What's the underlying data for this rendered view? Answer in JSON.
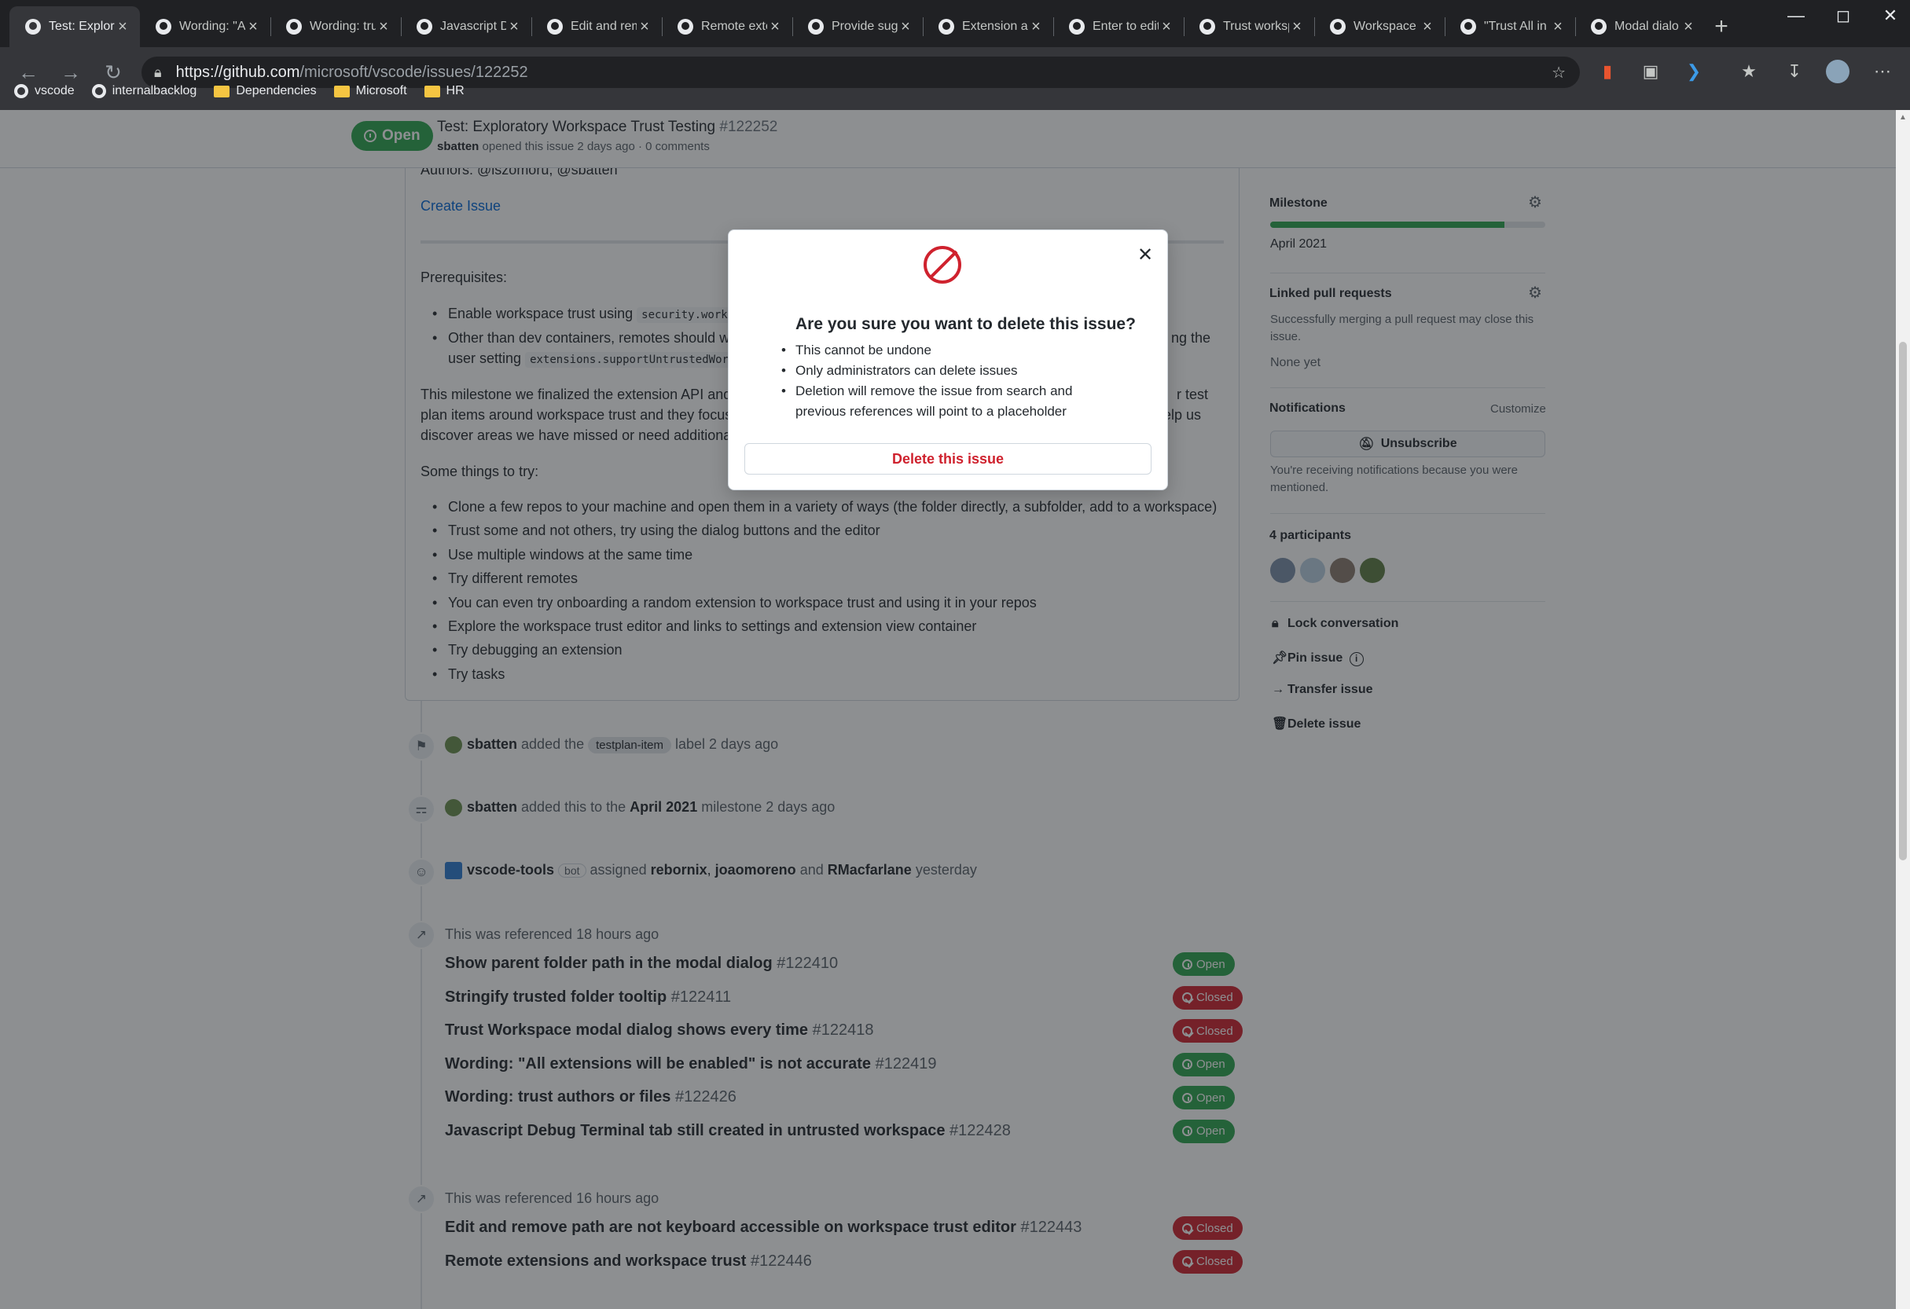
{
  "browser": {
    "tabs": [
      {
        "label": "Test: Explora",
        "active": true
      },
      {
        "label": "Wording: \"Al"
      },
      {
        "label": "Wording: tru"
      },
      {
        "label": "Javascript De"
      },
      {
        "label": "Edit and rem"
      },
      {
        "label": "Remote exte"
      },
      {
        "label": "Provide sugg"
      },
      {
        "label": "Extension ac"
      },
      {
        "label": "Enter to edit"
      },
      {
        "label": "Trust worksp"
      },
      {
        "label": "Workspace t"
      },
      {
        "label": "\"Trust All in"
      },
      {
        "label": "Modal dialo"
      }
    ],
    "url_host": "https://github.com",
    "url_path": "/microsoft/vscode/issues/122252",
    "bookmarks": [
      {
        "label": "vscode",
        "icon": "github-icon"
      },
      {
        "label": "internalbacklog",
        "icon": "github-icon"
      },
      {
        "label": "Dependencies",
        "icon": "folder-icon"
      },
      {
        "label": "Microsoft",
        "icon": "folder-icon"
      },
      {
        "label": "HR",
        "icon": "folder-icon"
      }
    ]
  },
  "issue": {
    "state": "Open",
    "title": "Test: Exploratory Workspace Trust Testing",
    "number": "#122252",
    "author": "sbatten",
    "meta": "opened this issue 2 days ago · 0 comments"
  },
  "comment": {
    "authors_line": "Authors: @iszomoru, @sbatten",
    "create_issue": "Create Issue",
    "prereq": "Prerequisites:",
    "bullet1_text": "Enable workspace trust using",
    "bullet1_code": "security.worksp",
    "bullet2_text_a": "Other than dev containers, remotes should wo",
    "bullet2_text_b": "ng the",
    "bullet2_text_c": "user setting",
    "bullet2_code": "extensions.supportUntrustedWork",
    "para1_l1a": "This milestone we finalized the extension API and h",
    "para1_l1b": "r test",
    "para1_l2a": "plan items around workspace trust and they focus",
    "para1_l2b": "elp us",
    "para1_l3": "discover areas we have missed or need additional l",
    "try_heading": "Some things to try:",
    "try_items": [
      "Clone a few repos to your machine and open them in a variety of ways (the folder directly, a subfolder, add to a workspace)",
      "Trust some and not others, try using the dialog buttons and the editor",
      "Use multiple windows at the same time",
      "Try different remotes",
      "You can even try onboarding a random extension to workspace trust and using it in your repos",
      "Explore the workspace trust editor and links to settings and extension view container",
      "Try debugging an extension",
      "Try tasks"
    ]
  },
  "timeline": {
    "label_event": {
      "user": "sbatten",
      "pre": "added the",
      "label": "testplan-item",
      "post": "label 2 days ago"
    },
    "milestone_event": {
      "user": "sbatten",
      "pre": "added this to the",
      "milestone": "April 2021",
      "post": "milestone 2 days ago"
    },
    "assign_event": {
      "user": "vscode-tools",
      "bot": "bot",
      "pre": "assigned",
      "a1": "rebornix",
      "a2": "joaomoreno",
      "and": "and",
      "a3": "RMacfarlane",
      "post": "yesterday"
    },
    "ref_group1": {
      "header": "This was referenced 18 hours ago",
      "items": [
        {
          "title": "Show parent folder path in the modal dialog",
          "num": "#122410",
          "state": "Open"
        },
        {
          "title": "Stringify trusted folder tooltip",
          "num": "#122411",
          "state": "Closed"
        },
        {
          "title": "Trust Workspace modal dialog shows every time",
          "num": "#122418",
          "state": "Closed"
        },
        {
          "title": "Wording: \"All extensions will be enabled\" is not accurate",
          "num": "#122419",
          "state": "Open"
        },
        {
          "title": "Wording: trust authors or files",
          "num": "#122426",
          "state": "Open"
        },
        {
          "title": "Javascript Debug Terminal tab still created in untrusted workspace",
          "num": "#122428",
          "state": "Open"
        }
      ]
    },
    "ref_group2": {
      "header": "This was referenced 16 hours ago",
      "items": [
        {
          "title": "Edit and remove path are not keyboard accessible on workspace trust editor",
          "num": "#122443",
          "state": "Closed"
        },
        {
          "title": "Remote extensions and workspace trust",
          "num": "#122446",
          "state": "Closed"
        }
      ]
    }
  },
  "sidebar": {
    "milestone_heading": "Milestone",
    "milestone_name": "April 2021",
    "milestone_progress": 0.85,
    "linked_heading": "Linked pull requests",
    "linked_desc_1": "Successfully merging a pull request may close this",
    "linked_desc_2": "issue.",
    "linked_none": "None yet",
    "notif_heading": "Notifications",
    "notif_customize": "Customize",
    "unsubscribe": "Unsubscribe",
    "notif_reason_1": "You're receiving notifications because you were",
    "notif_reason_2": "mentioned.",
    "participants": "4 participants",
    "actions": {
      "lock": "Lock conversation",
      "pin": "Pin issue",
      "transfer": "Transfer issue",
      "delete": "Delete issue"
    }
  },
  "modal": {
    "title": "Are you sure you want to delete this issue?",
    "items": [
      "This cannot be undone",
      "Only administrators can delete issues",
      "Deletion will remove the issue from search and previous references will point to a placeholder"
    ],
    "button": "Delete this issue"
  },
  "colors": {
    "open": "#2da44e",
    "closed": "#cf222e",
    "link": "#0366d6"
  }
}
